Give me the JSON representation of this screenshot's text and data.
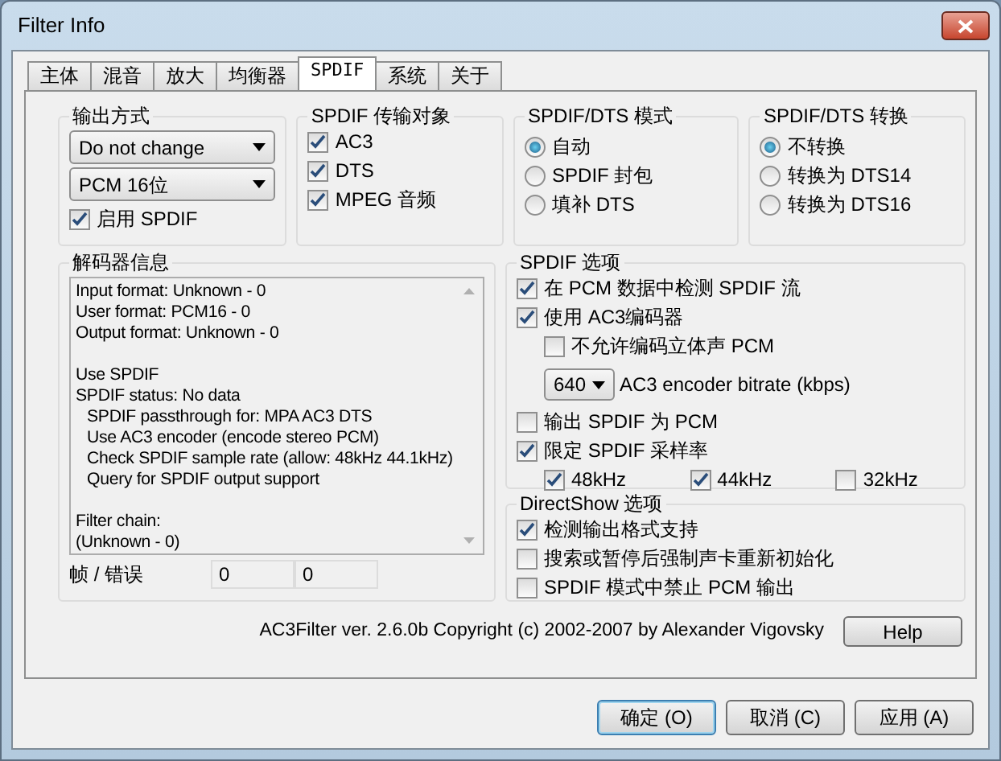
{
  "window": {
    "title": "Filter Info"
  },
  "tabs": [
    {
      "label": "主体",
      "selected": false
    },
    {
      "label": "混音",
      "selected": false
    },
    {
      "label": "放大",
      "selected": false
    },
    {
      "label": "均衡器",
      "selected": false
    },
    {
      "label": "SPDIF",
      "selected": true
    },
    {
      "label": "系统",
      "selected": false
    },
    {
      "label": "关于",
      "selected": false
    }
  ],
  "output_mode": {
    "title": "输出方式",
    "dropdowns": [
      "Do not change",
      "PCM 16位"
    ],
    "enable_spdif": {
      "label": "启用 SPDIF",
      "checked": true
    }
  },
  "spdif_targets": {
    "title": "SPDIF 传输对象",
    "items": [
      {
        "label": "AC3",
        "checked": true
      },
      {
        "label": "DTS",
        "checked": true
      },
      {
        "label": "MPEG 音频",
        "checked": true
      }
    ]
  },
  "spdif_dts_mode": {
    "title": "SPDIF/DTS 模式",
    "options": [
      {
        "label": "自动",
        "selected": true
      },
      {
        "label": "SPDIF 封包",
        "selected": false
      },
      {
        "label": "填补 DTS",
        "selected": false
      }
    ]
  },
  "spdif_dts_conversion": {
    "title": "SPDIF/DTS 转换",
    "options": [
      {
        "label": "不转换",
        "selected": true
      },
      {
        "label": "转换为 DTS14",
        "selected": false
      },
      {
        "label": "转换为 DTS16",
        "selected": false
      }
    ]
  },
  "decoder_info": {
    "title": "解码器信息",
    "blocks": [
      {
        "lines": [
          {
            "text": "Input format: Unknown - 0"
          },
          {
            "text": "User format: PCM16 - 0"
          },
          {
            "text": "Output format: Unknown - 0"
          }
        ]
      },
      {
        "lines": [
          {
            "text": "Use SPDIF"
          },
          {
            "text": "SPDIF status: No data",
            "children": [
              {
                "text": "SPDIF passthrough for: MPA AC3 DTS"
              },
              {
                "text": "Use AC3 encoder (encode stereo PCM)"
              },
              {
                "text": "Check SPDIF sample rate (allow: 48kHz 44.1kHz)"
              },
              {
                "text": "Query for SPDIF output support"
              }
            ]
          }
        ]
      },
      {
        "lines": [
          {
            "text": "Filter chain:"
          },
          {
            "text": "(Unknown - 0)"
          }
        ]
      }
    ],
    "frames_label": "帧 / 错误",
    "frames": "0",
    "errors": "0"
  },
  "spdif_options": {
    "title": "SPDIF 选项",
    "items": [
      {
        "kind": "checkbox",
        "label": "在 PCM 数据中检测 SPDIF 流",
        "checked": true
      },
      {
        "kind": "checkbox",
        "label": "使用 AC3编码器",
        "checked": true,
        "children": [
          {
            "kind": "checkbox",
            "label": "不允许编码立体声 PCM",
            "checked": false
          },
          {
            "kind": "select",
            "label": "AC3 encoder bitrate (kbps)",
            "value": "640"
          }
        ]
      },
      {
        "kind": "checkbox",
        "label": "输出 SPDIF 为 PCM",
        "checked": false
      },
      {
        "kind": "checkbox",
        "label": "限定 SPDIF 采样率",
        "checked": true,
        "children": [
          {
            "kind": "inline_checkbox",
            "label": "48kHz",
            "checked": true
          },
          {
            "kind": "inline_checkbox",
            "label": "44kHz",
            "checked": true
          },
          {
            "kind": "inline_checkbox",
            "label": "32kHz",
            "checked": false
          }
        ]
      }
    ]
  },
  "directshow_options": {
    "title": "DirectShow 选项",
    "items": [
      {
        "label": "检测输出格式支持",
        "checked": true
      },
      {
        "label": "搜索或暂停后强制声卡重新初始化",
        "checked": false
      },
      {
        "label": "SPDIF 模式中禁止 PCM 输出",
        "checked": false
      }
    ]
  },
  "copyright": "AC3Filter ver. 2.6.0b Copyright (c) 2002-2007 by Alexander Vigovsky",
  "help_button": "Help",
  "buttons": [
    {
      "label": "确定 (O)",
      "default": true
    },
    {
      "label": "取消 (C)",
      "default": false
    },
    {
      "label": "应用 (A)",
      "default": false
    }
  ]
}
